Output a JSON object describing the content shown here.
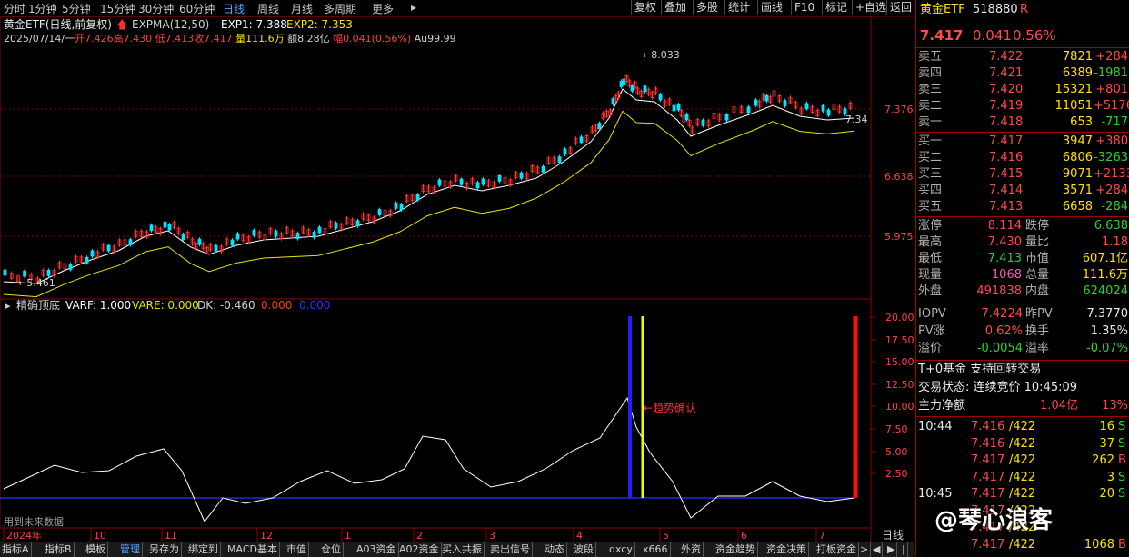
{
  "periods": [
    "分时",
    "1分钟",
    "5分钟",
    "15分钟",
    "30分钟",
    "60分钟",
    "日线",
    "周线",
    "月线",
    "多周期",
    "更多"
  ],
  "active_period": "日线",
  "toolbar": [
    "复权",
    "叠加",
    "多股",
    "统计",
    "画线",
    "F10",
    "标记",
    "+自选",
    "返回"
  ],
  "header": {
    "name": "黄金ETF(日线,前复权)",
    "ema_label": "EXPMA(12,50)",
    "exp1": "EXP1: 7.388",
    "exp2": "EXP2: 7.353",
    "date_line": "2025/07/14/一",
    "open": "开7.426",
    "high": "高7.430",
    "low": "低7.413",
    "close": "收7.417",
    "vol": "量111.6万",
    "amount": "额8.28亿",
    "change": "幅0.041(0.56%)",
    "au": "Au99.99"
  },
  "price_axis": [
    "7.376",
    "6.638",
    "5.975"
  ],
  "max_label": "8.033",
  "min_label": "5.461",
  "last_label": "7.34",
  "indicator": {
    "name": "精确顶底",
    "varf": "VARF: 1.000",
    "vare": "VARE: 0.000",
    "dk": "DK: -0.460",
    "v1": "0.000",
    "v2": "0.000",
    "annotation": "趋势确认",
    "note": "用到未来数据",
    "axis": [
      "20.00",
      "17.50",
      "15.00",
      "12.50",
      "10.00",
      "7.50",
      "5.00",
      "2.50"
    ]
  },
  "date_axis": [
    "2024年",
    "10",
    "11",
    "12",
    "1",
    "2",
    "3",
    "4",
    "5",
    "6",
    "7"
  ],
  "corner_label": "日线",
  "bottom_tabs": [
    "指标A",
    "指标B",
    "模板",
    "管理",
    "另存为",
    "绑定到",
    "MACD基本",
    "市值",
    "仓位",
    "A03资金",
    "A02资金",
    "买入共振",
    "卖出信号",
    "动态",
    "波段",
    "qxcy",
    "x666",
    "外资",
    "资金趋势",
    "资金决策",
    "打板资金"
  ],
  "active_tab": "管理",
  "panel": {
    "title": "黄金ETF",
    "code": "518880",
    "flag": "R",
    "price": "7.417",
    "change": "0.041",
    "pct": "0.56%",
    "asks": [
      {
        "label": "卖五",
        "price": "7.422",
        "vol": "7821",
        "chg": "+284"
      },
      {
        "label": "卖四",
        "price": "7.421",
        "vol": "6389",
        "chg": "-1981"
      },
      {
        "label": "卖三",
        "price": "7.420",
        "vol": "15321",
        "chg": "+801"
      },
      {
        "label": "卖二",
        "price": "7.419",
        "vol": "11051",
        "chg": "+5176"
      },
      {
        "label": "卖一",
        "price": "7.418",
        "vol": "653",
        "chg": "-717"
      }
    ],
    "bids": [
      {
        "label": "买一",
        "price": "7.417",
        "vol": "3947",
        "chg": "+380"
      },
      {
        "label": "买二",
        "price": "7.416",
        "vol": "6806",
        "chg": "-3263"
      },
      {
        "label": "买三",
        "price": "7.415",
        "vol": "9071",
        "chg": "+2133"
      },
      {
        "label": "买四",
        "price": "7.414",
        "vol": "3571",
        "chg": "+284"
      },
      {
        "label": "买五",
        "price": "7.413",
        "vol": "6658",
        "chg": "-284"
      }
    ],
    "stats": [
      {
        "l1": "涨停",
        "v1": "8.114",
        "l2": "跌停",
        "v2": "6.638"
      },
      {
        "l1": "最高",
        "v1": "7.430",
        "l2": "量比",
        "v2": "1.18"
      },
      {
        "l1": "最低",
        "v1": "7.413",
        "l2": "市值",
        "v2": "607.1亿"
      },
      {
        "l1": "现量",
        "v1": "1068",
        "l2": "总量",
        "v2": "111.6万"
      },
      {
        "l1": "外盘",
        "v1": "491838",
        "l2": "内盘",
        "v2": "624024"
      }
    ],
    "iopv": [
      {
        "l1": "IOPV",
        "v1": "7.4224",
        "l2": "昨PV",
        "v2": "7.3770"
      },
      {
        "l1": "PV涨",
        "v1": "0.62%",
        "l2": "换手",
        "v2": "1.35%"
      },
      {
        "l1": "溢价",
        "v1": "-0.0054",
        "l2": "溢率",
        "v2": "-0.07%"
      }
    ],
    "t0": "T+0基金 支持回转交易",
    "status": "交易状态: 连续竞价 10:45:09",
    "net_label": "主力净额",
    "net_value": "1.04亿",
    "net_pct": "13%",
    "ticks": [
      {
        "time": "10:44",
        "price": "7.416",
        "ref": "/422",
        "vol": "16",
        "side": "S"
      },
      {
        "time": "",
        "price": "7.416",
        "ref": "/422",
        "vol": "37",
        "side": "S"
      },
      {
        "time": "",
        "price": "7.417",
        "ref": "/422",
        "vol": "262",
        "side": "B"
      },
      {
        "time": "",
        "price": "7.417",
        "ref": "/422",
        "vol": "3",
        "side": "S"
      },
      {
        "time": "10:45",
        "price": "7.417",
        "ref": "/422",
        "vol": "20",
        "side": "S"
      },
      {
        "time": "",
        "price": "7.417",
        "ref": "/422",
        "vol": "",
        "side": ""
      },
      {
        "time": "",
        "price": "7.417",
        "ref": "/422",
        "vol": "",
        "side": ""
      },
      {
        "time": "",
        "price": "7.417",
        "ref": "/422",
        "vol": "1068",
        "side": "B"
      }
    ],
    "watermark": "@琴心浪客"
  }
}
